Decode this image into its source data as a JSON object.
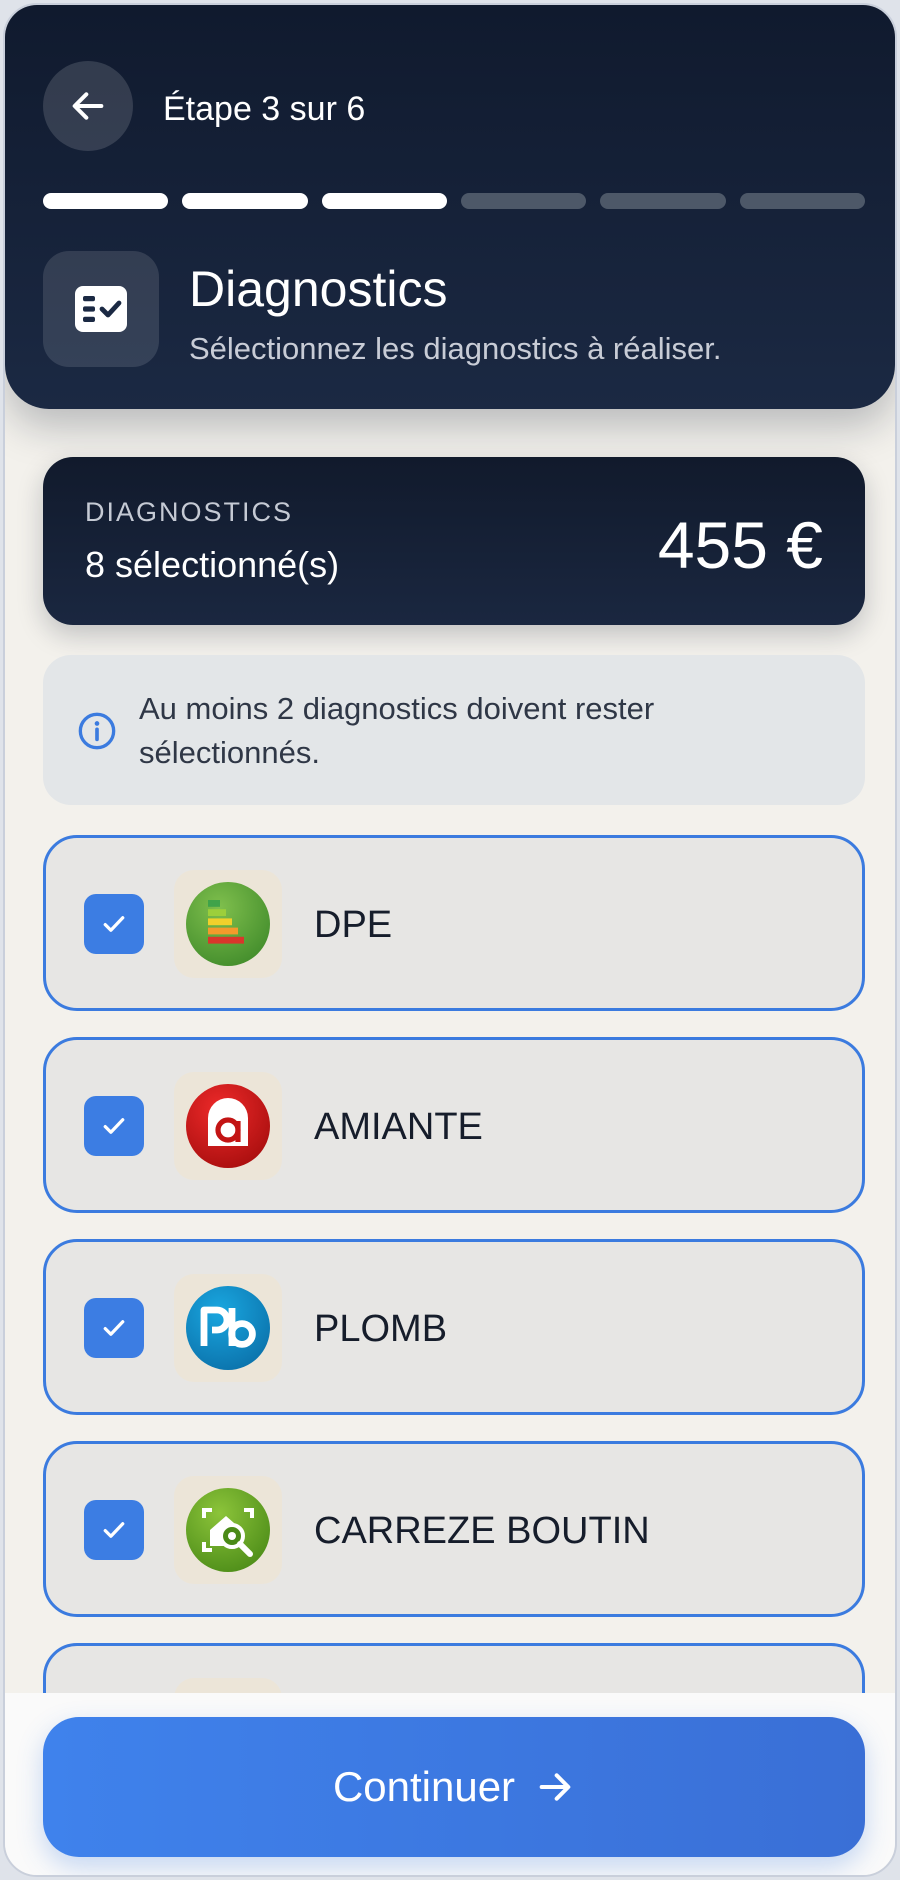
{
  "header": {
    "step_label": "Étape 3 sur 6",
    "progress": {
      "current": 3,
      "total": 6
    },
    "title": "Diagnostics",
    "subtitle": "Sélectionnez les diagnostics à réaliser."
  },
  "summary": {
    "kicker": "DIAGNOSTICS",
    "count": "8 sélectionné(s)",
    "price": "455 €"
  },
  "info": {
    "text": "Au moins 2 diagnostics doivent rester sélectionnés."
  },
  "diagnostics": [
    {
      "label": "DPE",
      "checked": true,
      "icon": "dpe-energy-icon"
    },
    {
      "label": "AMIANTE",
      "checked": true,
      "icon": "amiante-icon"
    },
    {
      "label": "PLOMB",
      "checked": true,
      "icon": "plomb-icon"
    },
    {
      "label": "CARREZE BOUTIN",
      "checked": true,
      "icon": "carrez-boutin-icon"
    },
    {
      "label": "",
      "checked": true,
      "icon": "diagnostic-icon"
    }
  ],
  "footer": {
    "cta_label": "Continuer"
  },
  "colors": {
    "header_bg": "#101a2e",
    "accent_blue": "#3c7de3",
    "card_bg": "#e7e6e4",
    "page_bg": "#f3f1ec"
  }
}
